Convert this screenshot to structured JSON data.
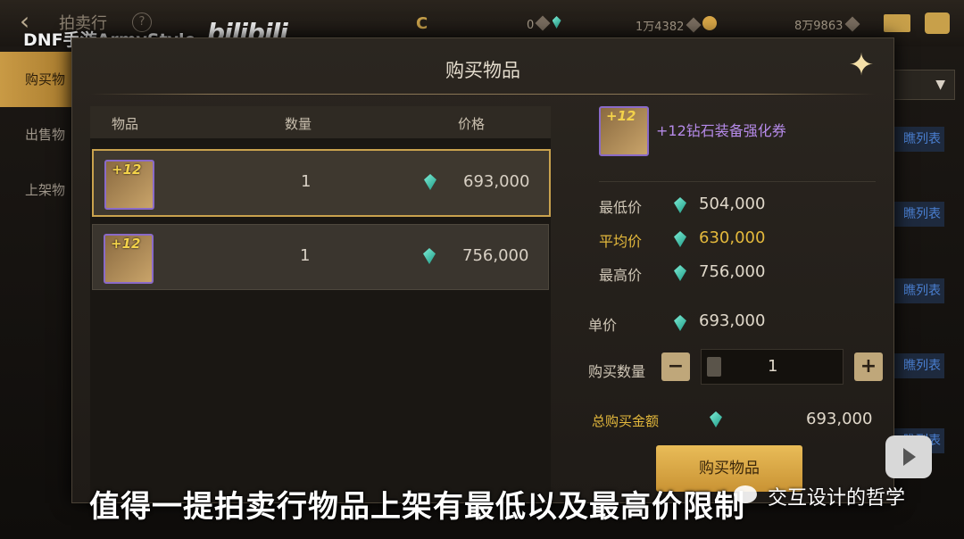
{
  "topbar": {
    "title": "拍卖行",
    "help": "?",
    "currency_c": "C",
    "c_amount": "0",
    "gem_amount": "1万4382",
    "gold_amount": "8万9863"
  },
  "watermark": {
    "channel": "DNF手游ArmyStyle",
    "bilibili": "bilibili"
  },
  "sidebar": {
    "items": [
      {
        "label": "购买物"
      },
      {
        "label": "出售物"
      },
      {
        "label": "上架物"
      }
    ]
  },
  "right_side": {
    "tag_label": "瞧列表"
  },
  "modal": {
    "title": "购买物品",
    "list": {
      "headers": [
        "物品",
        "数量",
        "价格"
      ],
      "rows": [
        {
          "badge": "+12",
          "qty": "1",
          "price": "693,000"
        },
        {
          "badge": "+12",
          "qty": "1",
          "price": "756,000"
        }
      ]
    },
    "detail": {
      "badge": "+12",
      "item_name": "+12钻石装备强化券",
      "min_label": "最低价",
      "min_value": "504,000",
      "avg_label": "平均价",
      "avg_value": "630,000",
      "max_label": "最高价",
      "max_value": "756,000",
      "unit_label": "单价",
      "unit_value": "693,000",
      "qty_label": "购买数量",
      "qty_minus": "−",
      "qty_value": "1",
      "qty_plus": "+",
      "total_label": "总购买金额",
      "total_value": "693,000",
      "buy_button": "购买物品"
    }
  },
  "subtitle": "值得一提拍卖行物品上架有最低以及最高价限制",
  "wechat_name": "交互设计的哲学",
  "colors": {
    "gold": "#e4b93c",
    "item_purple": "#b58ae8",
    "gem": "#2ec2a6",
    "button": "#d9a747"
  }
}
